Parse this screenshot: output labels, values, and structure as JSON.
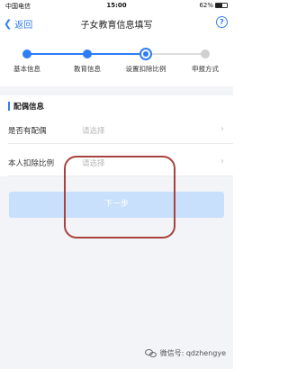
{
  "status_bar": {
    "carrier": "中国电信",
    "time": "15:00",
    "battery_percent_text": "62%",
    "battery_level": 0.62
  },
  "nav": {
    "back_label": "返回",
    "title": "子女教育信息填写",
    "help_label": "?"
  },
  "steps": [
    {
      "label": "基本信息",
      "state": "done"
    },
    {
      "label": "教育信息",
      "state": "done"
    },
    {
      "label": "设置扣除比例",
      "state": "current"
    },
    {
      "label": "申报方式",
      "state": "pending"
    }
  ],
  "section": {
    "title": "配偶信息"
  },
  "rows": [
    {
      "label": "是否有配偶",
      "placeholder": "请选择"
    },
    {
      "label": "本人扣除比例",
      "placeholder": "请选择"
    }
  ],
  "next_button": {
    "label": "下一步"
  },
  "watermark": {
    "text": "微信号: qdzhengye"
  },
  "colors": {
    "accent": "#2f7df6",
    "button_disabled": "#c8e0fb",
    "annotation": "#a8423d"
  }
}
